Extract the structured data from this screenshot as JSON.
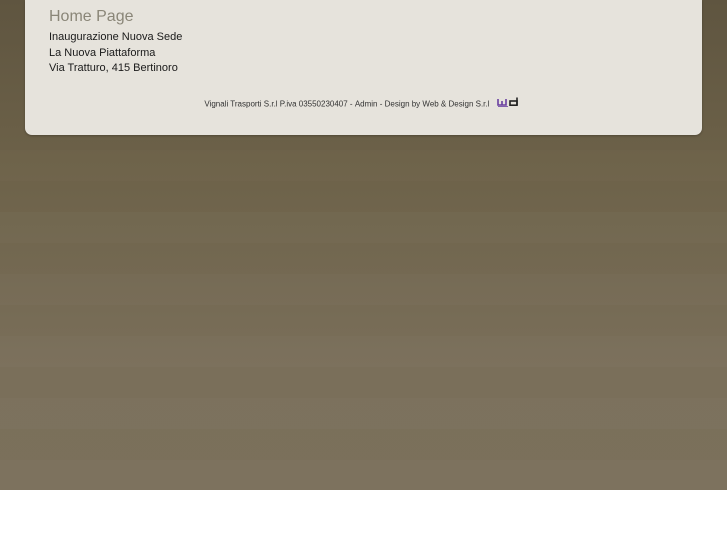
{
  "nav": {
    "home_label": "Home Page",
    "items": [
      {
        "label": "Inaugurazione Nuova Sede"
      },
      {
        "label": "La Nuova Piattaforma"
      },
      {
        "label": "Via Tratturo, 415 Bertinoro"
      }
    ]
  },
  "footer": {
    "company": "Vignali Trasporti S.r.l P.iva 03550230407",
    "sep1": " - ",
    "admin_label": "Admin",
    "sep2": " - ",
    "design_label": "Design by Web & Design S.r.l",
    "logo_icon": "wd-logo-icon",
    "logo_colors": {
      "w": "#6a3fa0",
      "d": "#222222"
    }
  },
  "colors": {
    "box_bg": "#e6e3dc",
    "page_bg_top": "#5f5540",
    "page_bg_bottom": "#7b705b",
    "home_link": "#8a8678"
  }
}
